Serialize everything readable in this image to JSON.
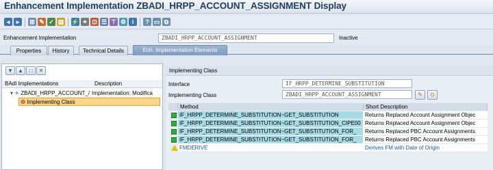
{
  "window": {
    "title": "Enhancement Implementation ZBADI_HRPP_ACCOUNT_ASSIGNMENT Display"
  },
  "toolbar": {
    "icons": [
      "back-icon",
      "forward-icon",
      "other-object-icon",
      "display-change-icon",
      "edit-icon",
      "object-list-icon",
      "activate-icon",
      "where-used-icon",
      "display-object-list-icon",
      "menu-painter-icon",
      "hierarchy-icon",
      "settings-icon",
      "info-icon",
      "help-icon",
      "docs-icon",
      "copy-icon"
    ]
  },
  "header": {
    "impl_label": "Enhancement Implementation",
    "impl_value": "ZBADI_HRPP_ACCOUNT_ASSIGNMENT",
    "status": "Inactive"
  },
  "tabs": [
    {
      "label": "Properties"
    },
    {
      "label": "History"
    },
    {
      "label": "Technical Details"
    },
    {
      "label": "Enh. Implementation Elements"
    }
  ],
  "tree": {
    "col_badi": "BAdI Implementations",
    "col_desc": "Description",
    "root_name": "ZBADI_HRPP_ACCOUNT_/",
    "root_desc": "Implementation: Modifica",
    "child_name": "Implementing Class"
  },
  "right": {
    "section_title": "Implementing Class",
    "interface_label": "Interface",
    "interface_value": "IF_HRPP_DETERMINE_SUBSTITUTION",
    "class_label": "Implementing Class",
    "class_value": "ZBADI_HRPP_ACCOUNT_ASSIGNMENT"
  },
  "table": {
    "col_method": "Method",
    "col_desc": "Short Description",
    "rows": [
      {
        "status": "active",
        "method": "IF_HRPP_DETERMINE_SUBSTITUTION~GET_SUBSTITUTION",
        "desc": "Returns Replaced Account Assignment Objec"
      },
      {
        "status": "active",
        "method": "IF_HRPP_DETERMINE_SUBSTITUTION~GET_SUBSTITUTION_CIPE00",
        "desc": "Returns Replaced Account Assignment Objec"
      },
      {
        "status": "active",
        "method": "IF_HRPP_DETERMINE_SUBSTITUTION~GET_SUBSTITUTION_FOR_",
        "desc": "Returns Replaced PBC Account Assignments"
      },
      {
        "status": "active",
        "method": "IF_HRPP_DETERMINE_SUBSTITUTION~GET_SUBSTITUTION_FOR_",
        "desc": "Returns Replaced PBC Account Assignments"
      },
      {
        "status": "warning",
        "method": "FMDERIVE",
        "desc": "Derives FM with Date of Origin"
      }
    ]
  },
  "colors": {
    "accent": "#1f3d62",
    "method_cell": "#a8dbe6",
    "selection": "#fbd38a"
  }
}
